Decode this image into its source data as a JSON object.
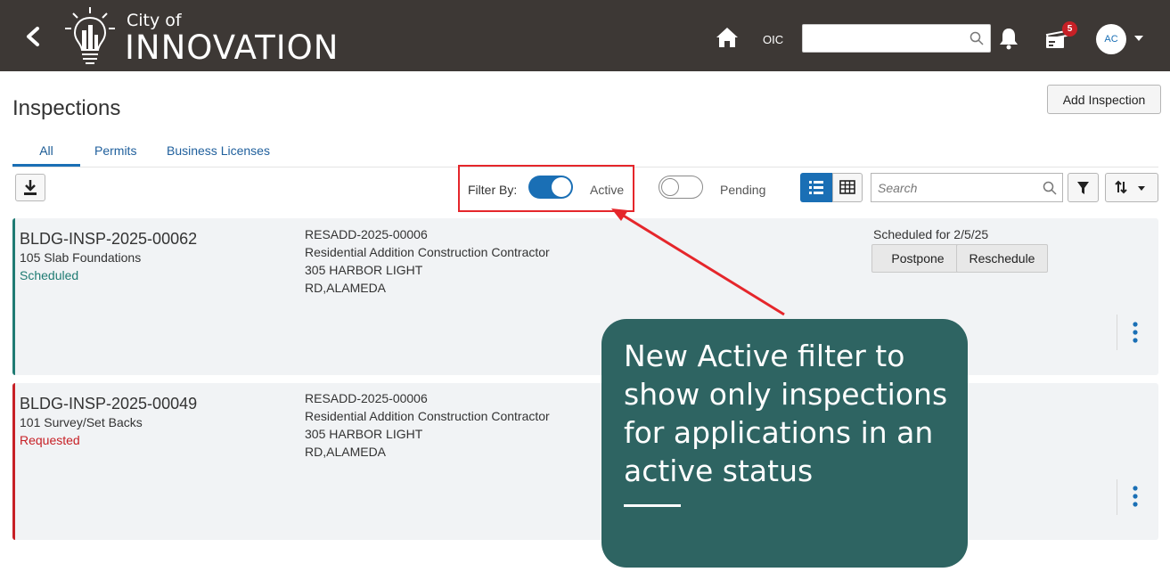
{
  "header": {
    "brand_small": "City of",
    "brand_big": "INNOVATION",
    "oic_label": "OIC",
    "search_value": "",
    "notification_count": "5",
    "avatar_initials": "AC",
    "bg_color": "#3d3835"
  },
  "page": {
    "title": "Inspections",
    "add_button": "Add Inspection",
    "tabs": [
      {
        "label": "All",
        "selected": true
      },
      {
        "label": "Permits",
        "selected": false
      },
      {
        "label": "Business Licenses",
        "selected": false
      }
    ]
  },
  "toolbar": {
    "filter_by_label": "Filter By:",
    "active_label": "Active",
    "active_on": true,
    "pending_label": "Pending",
    "pending_on": false,
    "search_placeholder": "Search",
    "view_mode": "list",
    "accent_color": "#1a6fb5"
  },
  "inspections": [
    {
      "id": "BLDG-INSP-2025-00062",
      "type": "105 Slab Foundations",
      "status": "Scheduled",
      "status_color": "#1f7b73",
      "application": "RESADD-2025-00006",
      "description": "Residential Addition Construction Contractor",
      "address_line1": "305 HARBOR LIGHT",
      "address_line2": "RD,ALAMEDA",
      "scheduled_text": "Scheduled for 2/5/25",
      "actions": [
        "Postpone",
        "Reschedule"
      ]
    },
    {
      "id": "BLDG-INSP-2025-00049",
      "type": "101 Survey/Set Backs",
      "status": "Requested",
      "status_color": "#c72026",
      "application": "RESADD-2025-00006",
      "description": "Residential Addition Construction Contractor",
      "address_line1": "305 HARBOR LIGHT",
      "address_line2": "RD,ALAMEDA"
    }
  ],
  "callout": {
    "text": "New Active filter to show only inspections for applications in an active status",
    "bg_color": "#2e6462",
    "arrow_color": "#e5262b"
  }
}
